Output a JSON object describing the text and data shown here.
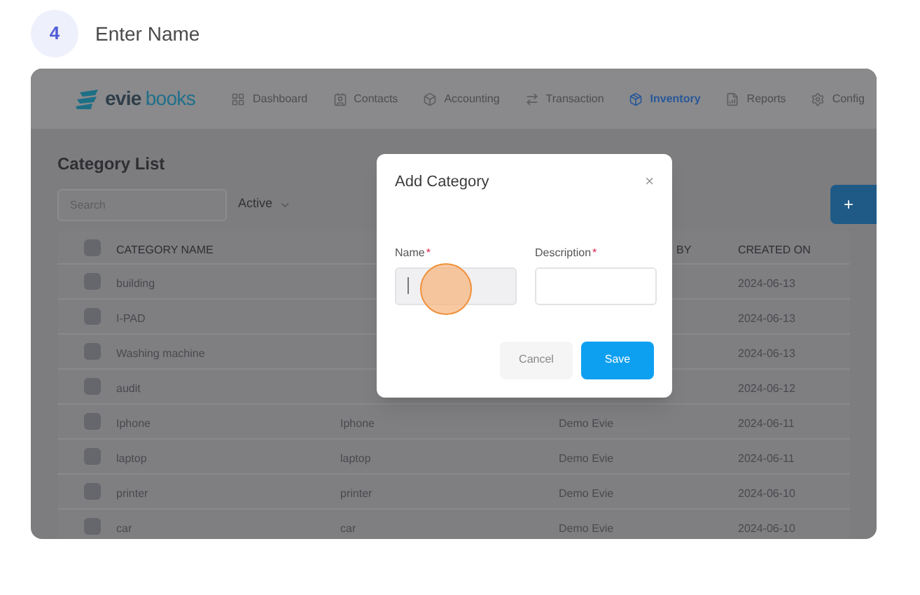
{
  "step": {
    "number": "4",
    "title": "Enter Name"
  },
  "app": {
    "logo": {
      "part_1": "evie",
      "part_2": "books"
    },
    "nav": [
      {
        "label": "Dashboard",
        "selected": false
      },
      {
        "label": "Contacts",
        "selected": false
      },
      {
        "label": "Accounting",
        "selected": false
      },
      {
        "label": "Transaction",
        "selected": false
      },
      {
        "label": "Inventory",
        "selected": true
      },
      {
        "label": "Reports",
        "selected": false
      },
      {
        "label": "Config",
        "selected": false
      }
    ],
    "page_title": "Category List",
    "search": {
      "placeholder": "Search"
    },
    "status_filter": "Active",
    "add_button": "+",
    "table": {
      "header_checked": false,
      "columns": [
        "CATEGORY NAME",
        "",
        "BY",
        "CREATED ON"
      ],
      "rows": [
        {
          "checked": false,
          "cells": [
            "building",
            "",
            "",
            "2024-06-13"
          ]
        },
        {
          "checked": false,
          "cells": [
            "I-PAD",
            "",
            "",
            "2024-06-13"
          ]
        },
        {
          "checked": false,
          "cells": [
            "Washing machine",
            "",
            "",
            "2024-06-13"
          ]
        },
        {
          "checked": false,
          "cells": [
            "audit",
            "",
            "",
            "2024-06-12"
          ]
        },
        {
          "checked": false,
          "cells": [
            "Iphone",
            "Iphone",
            "Demo Evie",
            "2024-06-11"
          ]
        },
        {
          "checked": false,
          "cells": [
            "laptop",
            "laptop",
            "Demo Evie",
            "2024-06-11"
          ]
        },
        {
          "checked": false,
          "cells": [
            "printer",
            "printer",
            "Demo Evie",
            "2024-06-10"
          ]
        },
        {
          "checked": false,
          "cells": [
            "car",
            "car",
            "Demo Evie",
            "2024-06-10"
          ]
        }
      ]
    }
  },
  "dialog": {
    "title": "Add Category",
    "close": "×",
    "fields": [
      {
        "label": "Name",
        "required_mark": "*",
        "focused": true
      },
      {
        "label": "Description",
        "required_mark": "*",
        "focused": false
      }
    ],
    "buttons": [
      {
        "label": "Cancel",
        "kind": "secondary"
      },
      {
        "label": "Save",
        "kind": "primary"
      }
    ]
  }
}
